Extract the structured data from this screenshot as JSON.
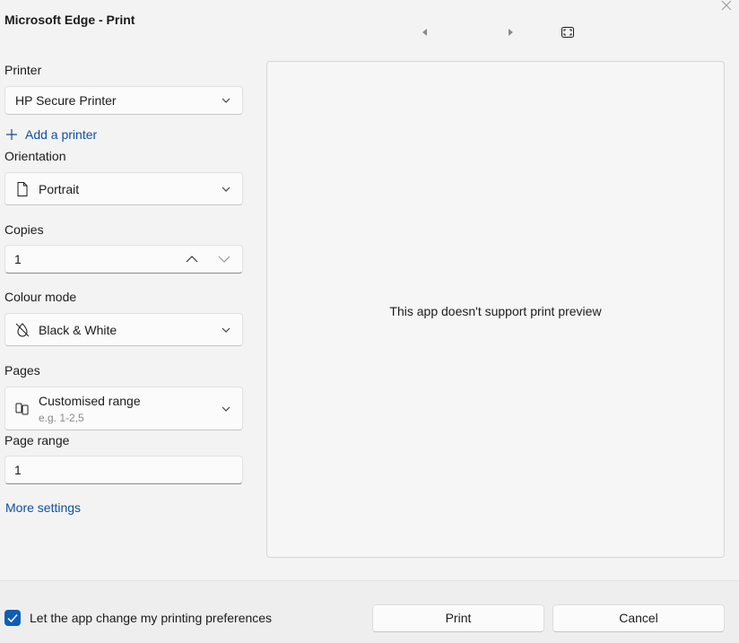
{
  "window": {
    "title": "Microsoft Edge - Print"
  },
  "printer": {
    "label": "Printer",
    "value": "HP Secure Printer",
    "add_label": "Add a printer"
  },
  "orientation": {
    "label": "Orientation",
    "value": "Portrait"
  },
  "copies": {
    "label": "Copies",
    "value": "1"
  },
  "colour_mode": {
    "label": "Colour mode",
    "value": "Black & White"
  },
  "pages": {
    "label": "Pages",
    "value": "Customised range",
    "hint": "e.g. 1-2,5"
  },
  "page_range": {
    "label": "Page range",
    "value": "1"
  },
  "more_settings": "More settings",
  "preview": {
    "message": "This app doesn't support print preview"
  },
  "footer": {
    "checkbox_label": "Let the app change my printing preferences",
    "checkbox_checked": true,
    "print_label": "Print",
    "cancel_label": "Cancel"
  },
  "colors": {
    "accent": "#0f5db5",
    "link": "#0f4fa0",
    "background": "#f3f3f3"
  },
  "icons": {
    "close": "close-icon",
    "prev": "triangle-left-icon",
    "next": "triangle-right-icon",
    "fit": "fit-page-icon",
    "add": "plus-icon",
    "orientation": "page-icon",
    "colour": "colour-off-icon",
    "pages": "pages-icon"
  }
}
